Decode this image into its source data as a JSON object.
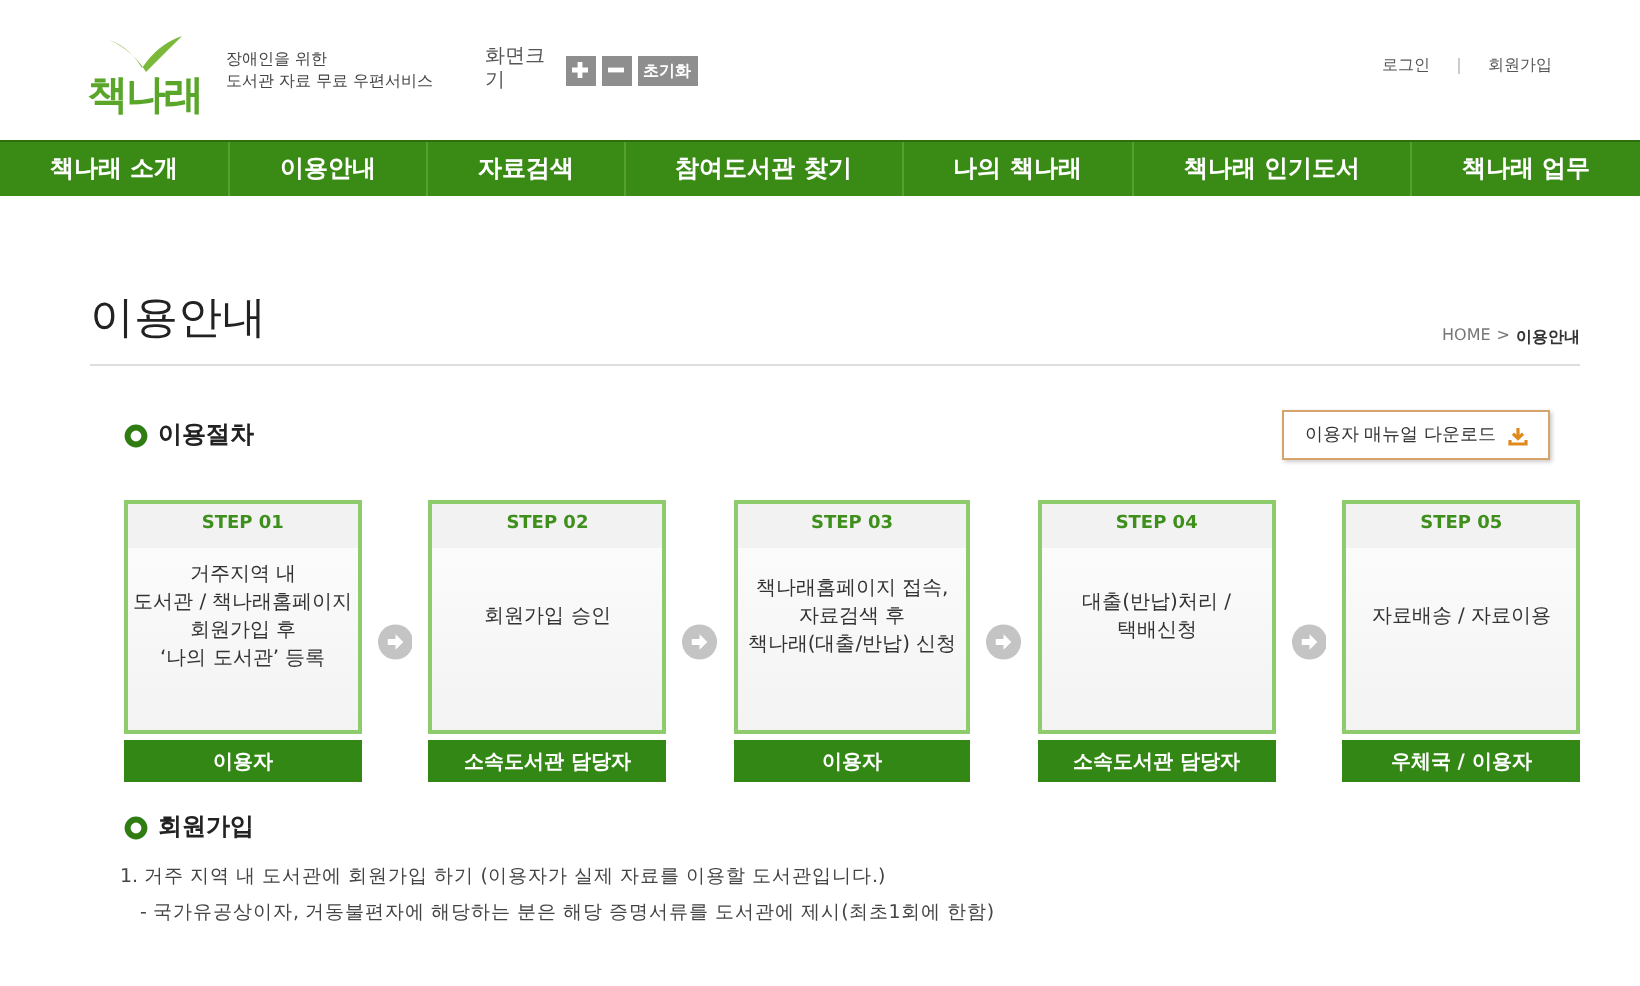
{
  "header": {
    "logo": "책나래",
    "tagline": [
      "장애인을 위한",
      "도서관 자료 무료 우편서비스"
    ],
    "font_size": {
      "label": "화면크기",
      "reset": "초기화"
    },
    "links": [
      "로그인",
      "회원가입"
    ]
  },
  "nav": [
    "책나래 소개",
    "이용안내",
    "자료검색",
    "참여도서관 찾기",
    "나의 책나래",
    "책나래 인기도서",
    "책나래 업무"
  ],
  "page_title": "이용안내",
  "breadcrumb": {
    "home": "HOME",
    "separator": ">",
    "current": "이용안내"
  },
  "procedure": {
    "heading": "이용절차",
    "download_button": "이용자 매뉴얼 다운로드",
    "steps": [
      {
        "label": "STEP 01",
        "text": [
          "거주지역 내",
          "도서관 / 책나래홈페이지",
          "회원가입 후",
          "‘나의 도서관’ 등록"
        ],
        "actor": "이용자"
      },
      {
        "label": "STEP 02",
        "text": [
          "회원가입 승인"
        ],
        "actor": "소속도서관 담당자"
      },
      {
        "label": "STEP 03",
        "text": [
          "책나래홈페이지 접속,",
          "자료검색 후",
          "책나래(대출/반납) 신청"
        ],
        "actor": "이용자"
      },
      {
        "label": "STEP 04",
        "text": [
          "대출(반납)처리 /",
          "택배신청"
        ],
        "actor": "소속도서관 담당자"
      },
      {
        "label": "STEP 05",
        "text": [
          "자료배송 / 자료이용"
        ],
        "actor": "우체국 / 이용자"
      }
    ]
  },
  "membership": {
    "heading": "회원가입",
    "lines": [
      "1. 거주 지역 내 도서관에 회원가입 하기 (이용자가 실제 자료를 이용할 도서관입니다.)",
      "- 국가유공상이자, 거동불편자에 해당하는 분은 해당 증명서류를 도서관에 제시(최초1회에 한함)"
    ]
  }
}
